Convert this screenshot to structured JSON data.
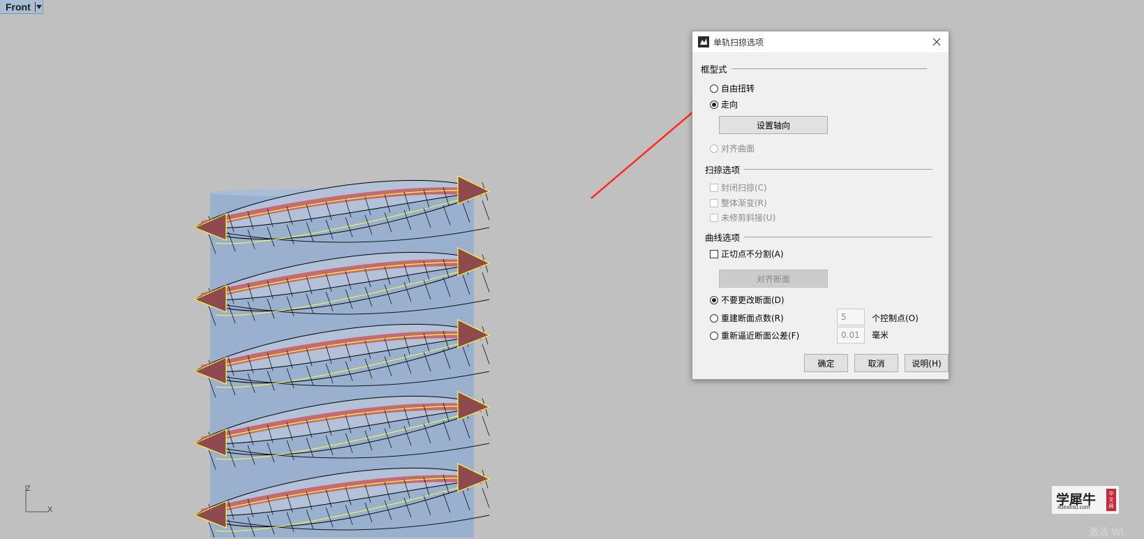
{
  "viewport": {
    "name": "Front",
    "axis": {
      "z": "Z",
      "x": "X"
    }
  },
  "dialog": {
    "title": "单轨扫掠选项",
    "frame_style": {
      "heading": "框型式",
      "options": [
        {
          "label": "自由扭转",
          "checked": false,
          "enabled": true
        },
        {
          "label": "走向",
          "checked": true,
          "enabled": true
        },
        {
          "label": "对齐曲面",
          "checked": false,
          "enabled": false
        }
      ],
      "set_axis_button": "设置轴向"
    },
    "sweep_options": {
      "heading": "扫掠选项",
      "items": [
        {
          "label": "封闭扫掠(C)",
          "checked": false,
          "enabled": false
        },
        {
          "label": "整体渐变(R)",
          "checked": false,
          "enabled": false
        },
        {
          "label": "未修剪斜接(U)",
          "checked": false,
          "enabled": false
        }
      ]
    },
    "curve_options": {
      "heading": "曲线选项",
      "tangent_split": {
        "label": "正切点不分割(A)",
        "checked": false
      },
      "align_button": "对齐断面",
      "options": [
        {
          "label": "不要更改断面(D)",
          "checked": true
        },
        {
          "label": "重建断面点数(R)",
          "checked": false
        },
        {
          "label": "重新逼近断面公差(F)",
          "checked": false
        }
      ],
      "rebuild_points": {
        "value": "5",
        "unit": "个控制点(O)"
      },
      "refit_tolerance": {
        "value": "0.01",
        "unit": "毫米"
      }
    },
    "buttons": {
      "ok": "确定",
      "cancel": "取消",
      "help": "说明(H)"
    }
  },
  "watermark": {
    "main": "学犀牛",
    "sub": "xuexiniu.com",
    "seal": [
      "中",
      "文",
      "网"
    ]
  },
  "activation_text": "激活 Wi",
  "colors": {
    "background": "#c0c0c0",
    "cylinder": "#9ab0cf",
    "spring_edges": "#000000",
    "rail_curve": "#ffff33",
    "ribbon": "#c85a60",
    "arrow": "#ff2a1a"
  }
}
